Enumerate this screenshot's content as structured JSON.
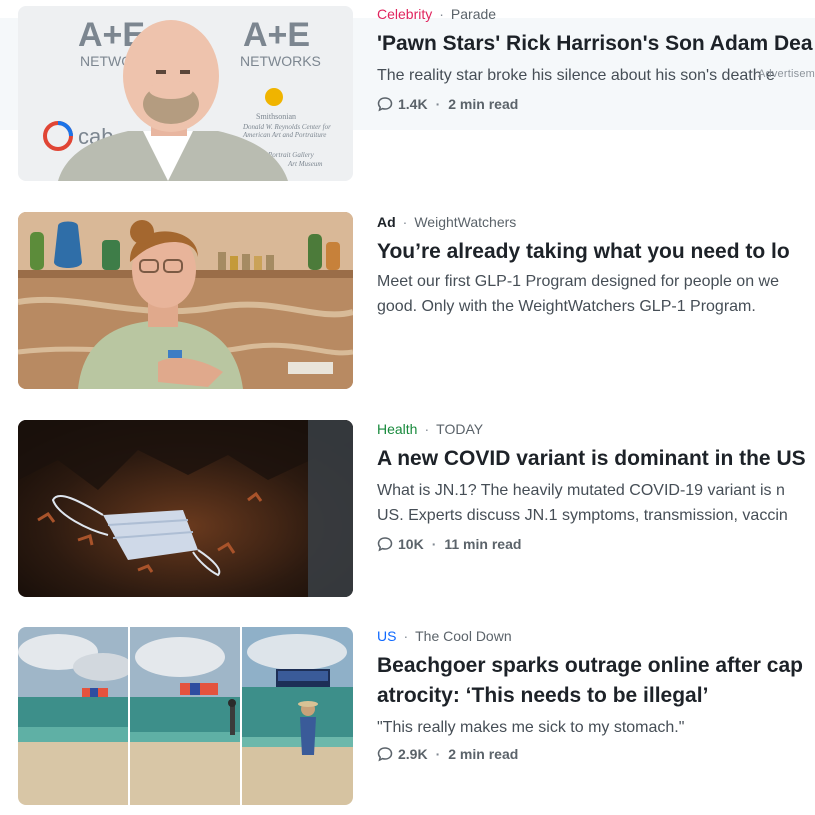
{
  "items": [
    {
      "category": "Celebrity",
      "category_color": "#e0245e",
      "source": "Parade",
      "title": "'Pawn Stars' Rick Harrison's Son Adam Dea",
      "desc": "The reality star broke his silence about his son's death e",
      "ad_label": "Advertisement",
      "comments": "1.4K",
      "read_time": "2 min read",
      "thumb_text": {
        "logo_left": "A+E",
        "logo_right": "A+E",
        "networks_left": "NETWORKS",
        "networks_right": "NETWORKS",
        "smithsonian": "Smithsonian",
        "reynolds_1": "Donald W. Reynolds Center for",
        "reynolds_2": "American Art and Portraiture",
        "portrait_1": "Portrait Gallery",
        "portrait_2": "Art Museum",
        "cable": "cab"
      }
    },
    {
      "category": "Ad",
      "category_color": "#1d2228",
      "source": "WeightWatchers",
      "title": "You’re already taking what you need to lo",
      "desc_line1": "Meet our first GLP-1 Program designed for people on we",
      "desc_line2": "good. Only with the WeightWatchers GLP-1 Program."
    },
    {
      "category": "Health",
      "category_color": "#188a3c",
      "source": "TODAY",
      "title": "A new COVID variant is dominant in the US",
      "desc_line1": "What is JN.1? The heavily mutated COVID-19 variant is n",
      "desc_line2": "US. Experts discuss JN.1 symptoms, transmission, vaccin",
      "comments": "10K",
      "read_time": "11 min read"
    },
    {
      "category": "US",
      "category_color": "#0f69ff",
      "source": "The Cool Down",
      "title_line1": "Beachgoer sparks outrage online after cap",
      "title_line2": "atrocity: ‘This needs to be illegal’",
      "desc": "\"This really makes me sick to my stomach.\"",
      "comments": "2.9K",
      "read_time": "2 min read"
    }
  ],
  "icons": {
    "comment": "comment-icon"
  }
}
